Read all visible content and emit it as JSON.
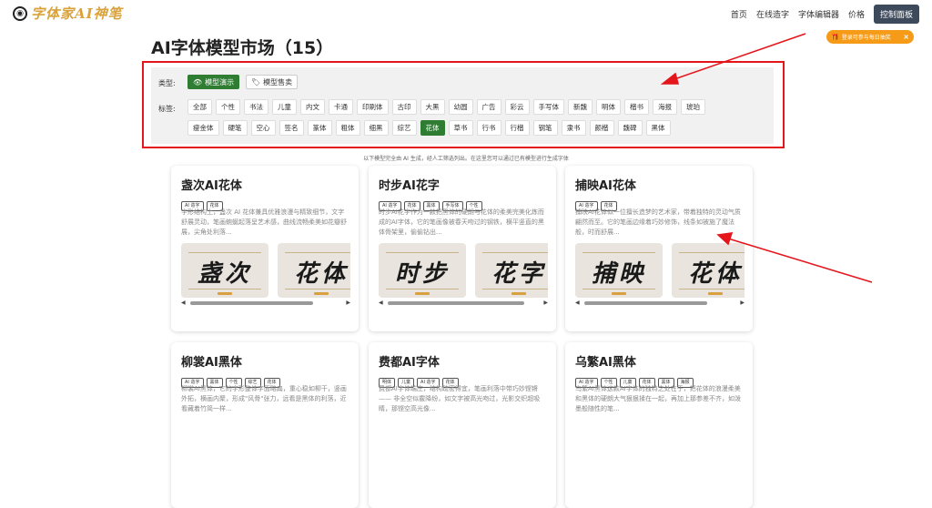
{
  "header": {
    "logo_text": "字体家AI神笔",
    "nav": [
      "首页",
      "在线造字",
      "字体编辑器",
      "价格"
    ],
    "dashboard_button": "控制面板"
  },
  "notice": {
    "text": "登录可参与每日抽奖",
    "close": "×"
  },
  "page_title": "AI字体模型市场（15）",
  "filter": {
    "type_label": "类型:",
    "types": [
      {
        "label": "模型演示",
        "active": true
      },
      {
        "label": "模型售卖",
        "active": false
      }
    ],
    "tag_label": "标签:",
    "tags_row1": [
      "全部",
      "个性",
      "书法",
      "儿童",
      "内文",
      "卡通",
      "印刷体",
      "古印",
      "大黑",
      "幼圆",
      "广告",
      "彩云",
      "手写体",
      "新魏",
      "明体",
      "楷书",
      "海报",
      "琥珀"
    ],
    "tags_row2": [
      "瘦金体",
      "硬笔",
      "空心",
      "签名",
      "篆体",
      "粗体",
      "细黑",
      "综艺",
      "花体",
      "草书",
      "行书",
      "行楷",
      "钢笔",
      "隶书",
      "颜楷",
      "魏碑",
      "黑体"
    ],
    "active_tag": "花体"
  },
  "subnote": "以下模型完全由 AI 生成，经人工筛选列出。在这里您可以通过已有模型进行生成字体",
  "cards": [
    {
      "title": "盏次AI花体",
      "tags": [
        "AI 造字",
        "花体"
      ],
      "desc": "字形结构上，盏次 AI 花体兼具优雅浪漫与精致细节，文字舒展灵动，笔画蜿蜒起落呈艺术感，曲线流畅柔美如花瓣舒展，尖角处利落...",
      "thumbs": [
        "盏次",
        "花体"
      ]
    },
    {
      "title": "时步AI花字",
      "tags": [
        "AI 造字",
        "花体",
        "黑体",
        "手写体",
        "个性"
      ],
      "desc": "时步AI花字作为一款把黑体的硬朗与花体的柔美完美化炼而成的AI字体，它的笔画像被春天吻过的钢铁，横平竖直的黑体骨架里，偷偷钻出...",
      "thumbs": [
        "时步",
        "花字"
      ]
    },
    {
      "title": "捕映AI花体",
      "tags": [
        "AI 造字",
        "花体"
      ],
      "desc": "捕映AI花体似一位擅长造梦的艺术家，带着独特的灵动气质翩然而至。它的笔画边缘着巧妙修饰，线条如被施了魔法般，时而舒展...",
      "thumbs": [
        "捕映",
        "花体"
      ]
    },
    {
      "title": "柳裳AI黑体",
      "tags": [
        "AI 造字",
        "黑体",
        "个性",
        "综艺",
        "花体"
      ],
      "desc": "柳裳AI黑体，它的字形整体字面略扁，重心稳如柳干，竖画外拓，横画内聚，形成\"风骨\"张力，远看是黑体的利落，近看藏着竹简一样...",
      "thumbs": []
    },
    {
      "title": "费都AI字体",
      "tags": [
        "明体",
        "儿童",
        "AI 造字",
        "花体"
      ],
      "desc": "费都AI字体端庄，结构疏密得宜，笔画利落中带巧妙铿锵 —— 非全空似霰降纷，如文字被高光吻过，光影交织超吸睛，那铿空高光像...",
      "thumbs": []
    },
    {
      "title": "乌繁AI黑体",
      "tags": [
        "AI 造字",
        "个性",
        "儿童",
        "花体",
        "黑体",
        "海报"
      ],
      "desc": "乌繁AI黑体这款AI字体的独特之处在于，把花体的浪漫柔美和黑体的硬朗大气狠狠揉在一起，再加上那参差不齐，如泼墨般随性的笔...",
      "thumbs": []
    }
  ]
}
